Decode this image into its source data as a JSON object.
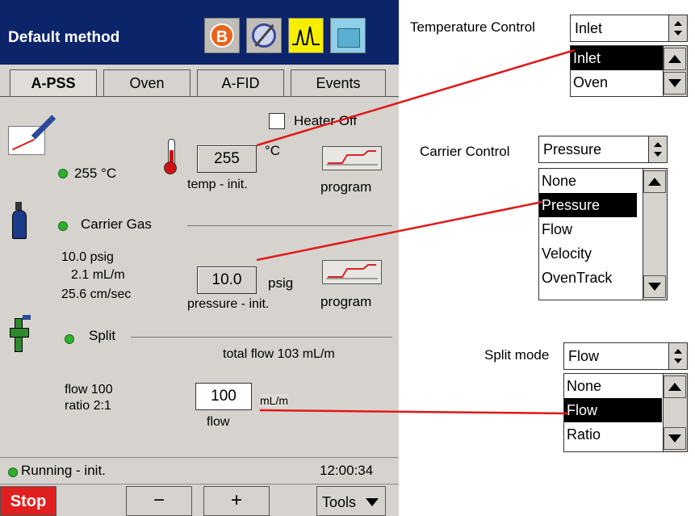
{
  "method": {
    "title": "Default method"
  },
  "tabs": [
    "A-PSS",
    "Oven",
    "A-FID",
    "Events"
  ],
  "inlet": {
    "heater_off_label": "Heater Off",
    "status_temp": "255 °C",
    "temp_value": "255",
    "temp_unit": "°C",
    "temp_caption": "temp - init.",
    "program_label": "program"
  },
  "carrier": {
    "section_label": "Carrier Gas",
    "pressure_readout": "10.0 psig",
    "flow_readout": "2.1 mL/m",
    "velocity_readout": "25.6 cm/sec",
    "pressure_value": "10.0",
    "pressure_unit": "psig",
    "pressure_caption": "pressure - init.",
    "program_label": "program"
  },
  "split": {
    "section_label": "Split",
    "total_flow": "total flow  103 mL/m",
    "flow_readout": "flow 100",
    "ratio_readout": "ratio 2:1",
    "flow_value": "100",
    "flow_unit": "mL/m",
    "flow_caption": "flow"
  },
  "status": {
    "text": "Running - init.",
    "time": "12:00:34"
  },
  "bottom": {
    "stop": "Stop",
    "minus": "−",
    "plus": "+",
    "tools": "Tools"
  },
  "temperature_control": {
    "label": "Temperature Control",
    "selected": "Inlet",
    "options": [
      "Inlet",
      "Oven"
    ]
  },
  "carrier_control": {
    "label": "Carrier Control",
    "selected": "Pressure",
    "options": [
      "None",
      "Pressure",
      "Flow",
      "Velocity",
      "OvenTrack"
    ]
  },
  "split_mode": {
    "label": "Split mode",
    "selected": "Flow",
    "options": [
      "None",
      "Flow",
      "Ratio"
    ]
  },
  "colors": {
    "title_bar": "#0b246a",
    "status_led": "#2db02d",
    "stop_button": "#e02020",
    "connector_line": "#e01818"
  }
}
